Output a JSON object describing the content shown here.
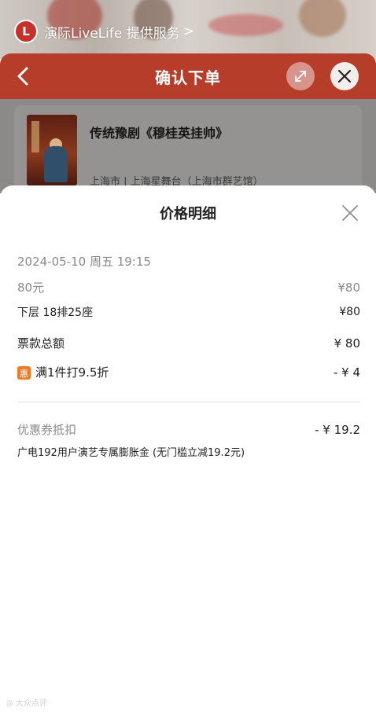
{
  "provider": {
    "name": "演际LiveLife 提供服务",
    "chevron": ">"
  },
  "header": {
    "title": "确认下单"
  },
  "show": {
    "title": "传统豫剧《穆桂英挂帅》",
    "venue": "上海市 | 上海星舞台（上海市群艺馆）"
  },
  "sheet": {
    "title": "价格明细",
    "datetime": "2024-05-10 周五 19:15",
    "tier_label": "80元",
    "tier_price": "¥80",
    "seat_label": "下层 18排25座",
    "seat_price": "¥80",
    "total_label": "票款总额",
    "total_value": "¥ 80",
    "promo_badge": "惠",
    "promo_label": "满1件打9.5折",
    "promo_value": "- ¥ 4",
    "coupon_label": "优惠券抵扣",
    "coupon_value": "- ¥ 19.2",
    "coupon_desc": "广电192用户演艺专属膨胀金 (无门槛立减19.2元)"
  },
  "colors": {
    "brand": "#b63d2a",
    "promo": "#f07a22"
  }
}
